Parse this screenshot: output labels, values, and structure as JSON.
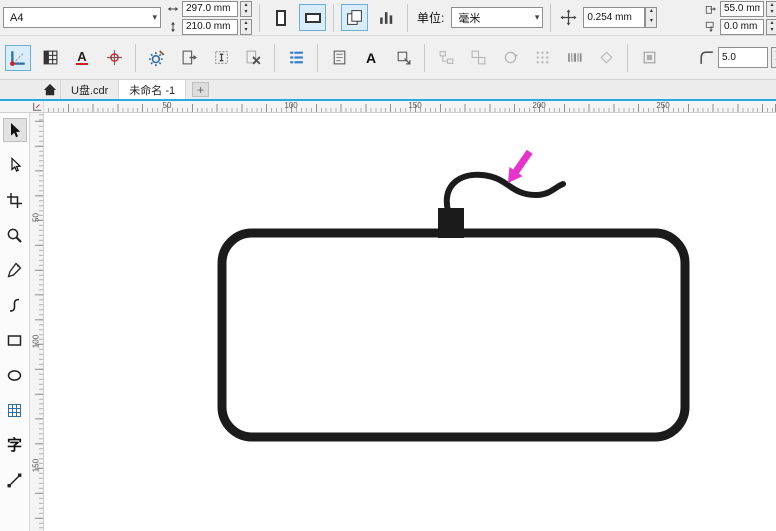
{
  "property_bar": {
    "page_size": "A4",
    "paper_width": "297.0 mm",
    "paper_height": "210.0 mm",
    "units_label": "单位:",
    "units_value": "毫米",
    "nudge_offset": "0.254 mm",
    "duplicate_distance_x": "55.0 mm",
    "duplicate_distance_y": "0.0 mm"
  },
  "secondary_toolbar": {
    "corner_radius": "5.0"
  },
  "tab_bar": {
    "tabs": [
      {
        "label": "U盘.cdr",
        "active": false
      },
      {
        "label": "未命名 -1",
        "active": true
      }
    ],
    "new_tab_label": "+"
  },
  "rulers": {
    "horizontal_labels": [
      "50",
      "100",
      "150",
      "200",
      "250"
    ],
    "vertical_labels": [
      "50",
      "100",
      "150"
    ]
  },
  "glyphs": {
    "dropdown_arrow": "▾",
    "spin_up": "▴",
    "spin_down": "▾",
    "font_list_a": "A",
    "bold_a": "A",
    "text_tool": "字",
    "plus": "+"
  },
  "colors": {
    "accent_blue": "#29a9e1",
    "arrow_magenta": "#e832cc",
    "drawing_stroke": "#1b1b1b",
    "selected_button_bg": "#d9ecf9"
  }
}
